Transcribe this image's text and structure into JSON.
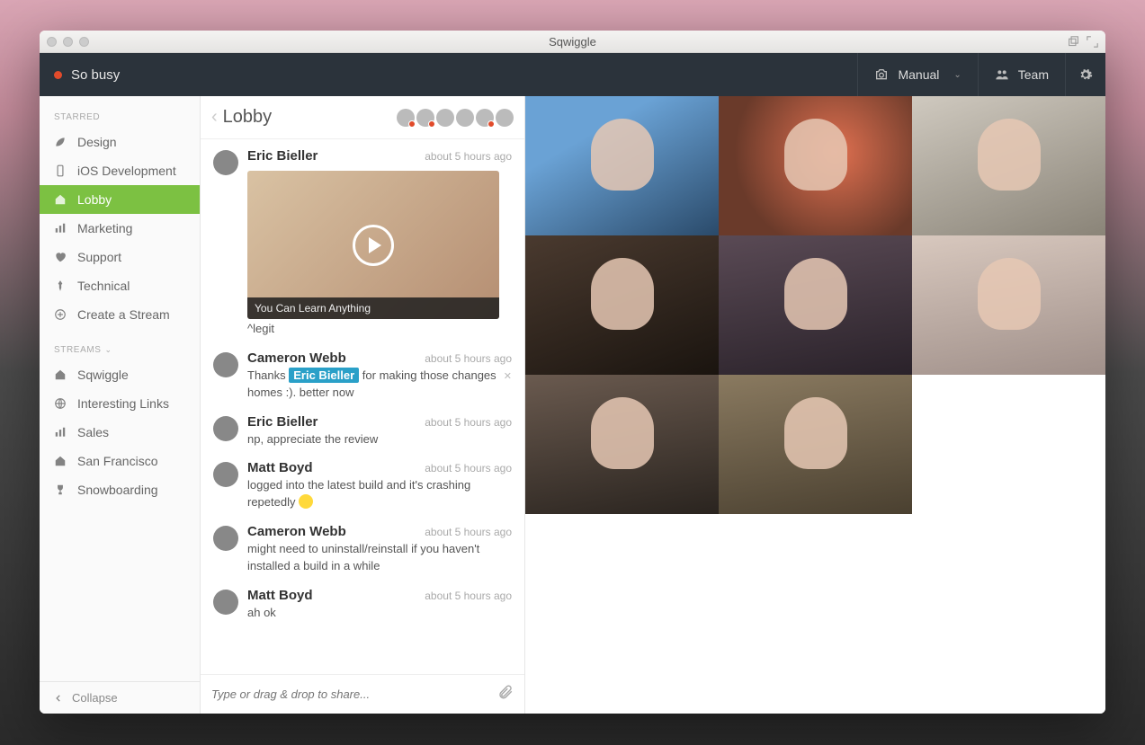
{
  "window": {
    "title": "Sqwiggle"
  },
  "topbar": {
    "status_text": "So busy",
    "camera_label": "Manual",
    "team_label": "Team"
  },
  "sidebar": {
    "starred_label": "STARRED",
    "starred": [
      {
        "icon": "leaf",
        "label": "Design"
      },
      {
        "icon": "phone",
        "label": "iOS Development"
      },
      {
        "icon": "home",
        "label": "Lobby",
        "active": true
      },
      {
        "icon": "bars",
        "label": "Marketing"
      },
      {
        "icon": "heart",
        "label": "Support"
      },
      {
        "icon": "pin",
        "label": "Technical"
      },
      {
        "icon": "plus",
        "label": "Create a Stream"
      }
    ],
    "streams_label": "STREAMS",
    "streams": [
      {
        "icon": "home",
        "label": "Sqwiggle"
      },
      {
        "icon": "globe",
        "label": "Interesting Links"
      },
      {
        "icon": "bars",
        "label": "Sales"
      },
      {
        "icon": "home",
        "label": "San Francisco"
      },
      {
        "icon": "trophy",
        "label": "Snowboarding"
      }
    ],
    "collapse_label": "Collapse"
  },
  "chat": {
    "room_name": "Lobby",
    "header_avatars": [
      {
        "status": "busy"
      },
      {
        "status": "busy"
      },
      {
        "status": "none"
      },
      {
        "status": "none"
      },
      {
        "status": "busy"
      },
      {
        "status": "none"
      }
    ],
    "messages": [
      {
        "author": "Eric Bieller",
        "time": "about 5 hours ago",
        "video_caption": "You Can Learn Anything",
        "text": "^legit"
      },
      {
        "author": "Cameron Webb",
        "time": "about 5 hours ago",
        "text_pre": "Thanks ",
        "mention": "Eric Bieller",
        "text_post": " for making those changes homes :). better now",
        "closable": true
      },
      {
        "author": "Eric Bieller",
        "time": "about 5 hours ago",
        "text": "np, appreciate the review"
      },
      {
        "author": "Matt Boyd",
        "time": "about 5 hours ago",
        "text": "logged into the latest build and it's crashing repetedly ",
        "emoji": true
      },
      {
        "author": "Cameron Webb",
        "time": "about 5 hours ago",
        "text": "might need to uninstall/reinstall if you haven't installed a build in a while"
      },
      {
        "author": "Matt Boyd",
        "time": "about 5 hours ago",
        "text": "ah ok"
      }
    ],
    "input_placeholder": "Type or drag & drop to share..."
  },
  "video_tiles": [
    1,
    2,
    3,
    4,
    5,
    6,
    7,
    8
  ]
}
